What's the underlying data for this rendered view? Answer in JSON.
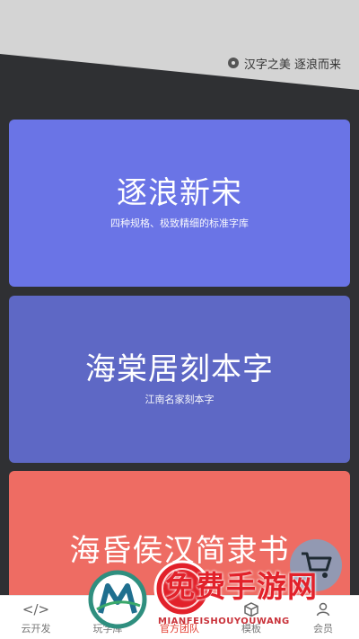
{
  "header": {
    "tagline": "汉字之美 逐浪而来"
  },
  "cards": [
    {
      "title": "逐浪新宋",
      "subtitle": "四种规格、极致精细的标准字库",
      "color": "#6a74e6"
    },
    {
      "title": "海棠居刻本字",
      "subtitle": "江南名家刻本字",
      "color": "#5e68c5"
    },
    {
      "title": "海昏侯汉简隶书",
      "subtitle": "",
      "color": "#ee6c63"
    }
  ],
  "tabbar": {
    "tabs": [
      {
        "label": "云开发",
        "icon": "code-icon"
      },
      {
        "label": "玩字库",
        "icon": "grid-icon"
      },
      {
        "label": "官方团队",
        "icon": "team-icon",
        "active": true
      },
      {
        "label": "模板",
        "icon": "cube-icon"
      },
      {
        "label": "会员",
        "icon": "user-icon"
      }
    ]
  },
  "watermark": {
    "text": "免费手游网",
    "subtext": "MIANFEISHOUYOUWANG",
    "badge_letters": "免费"
  },
  "colors": {
    "accent": "#e23a2e",
    "top_bg": "#d4d4d4",
    "page_bg": "#2f3033"
  }
}
